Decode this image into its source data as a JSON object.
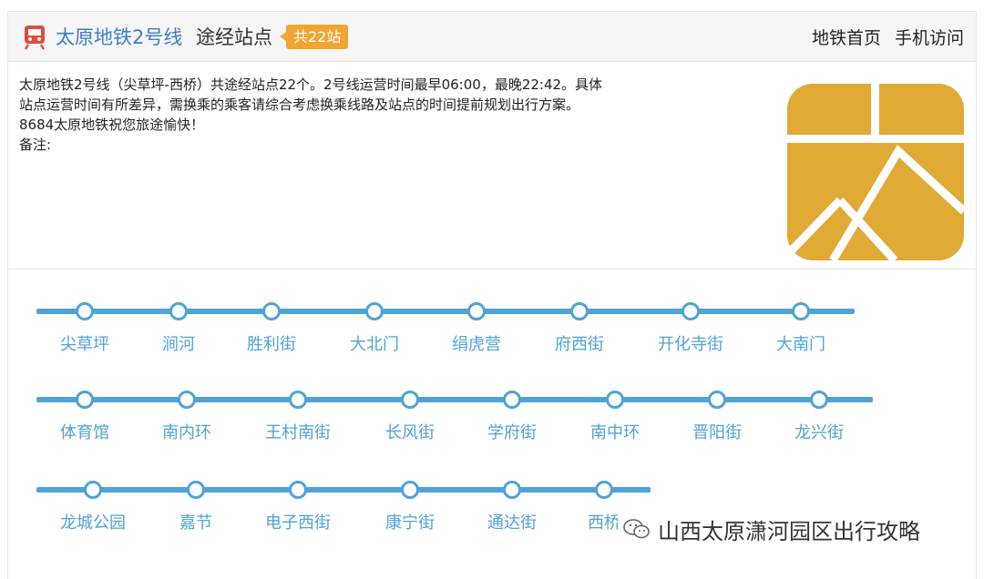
{
  "header": {
    "line_name": "太原地铁2号线",
    "subtitle": "途经站点",
    "badge": "共22站",
    "nav": [
      "地铁首页",
      "手机访问"
    ]
  },
  "description": {
    "lines": [
      "太原地铁2号线（尖草坪-西桥）共途经站点22个。2号线运营时间最早06:00，最晚22:42。具体",
      "站点运营时间有所差异，需换乘的乘客请综合考虑换乘线路及站点的时间提前规划出行方案。",
      "8684太原地铁祝您旅途愉快！",
      "备注:"
    ]
  },
  "colors": {
    "accent": "#4fa3d6",
    "logo": "#e0aa35",
    "badge": "#f0a630",
    "title": "#3d7fc1",
    "icon_red": "#e04b3e"
  },
  "rows": [
    {
      "stations": [
        "尖草坪",
        "涧河",
        "胜利街",
        "大北门",
        "绢虎营",
        "府西街",
        "开化寺街",
        "大南门"
      ]
    },
    {
      "stations": [
        "体育馆",
        "南内环",
        "王村南街",
        "长风街",
        "学府街",
        "南中环",
        "晋阳街",
        "龙兴街"
      ]
    },
    {
      "stations": [
        "龙城公园",
        "嘉节",
        "电子西街",
        "康宁街",
        "通达街",
        "西桥"
      ]
    }
  ],
  "watermark": {
    "text": "山西太原潇河园区出行攻略",
    "icon": "wechat-icon"
  }
}
